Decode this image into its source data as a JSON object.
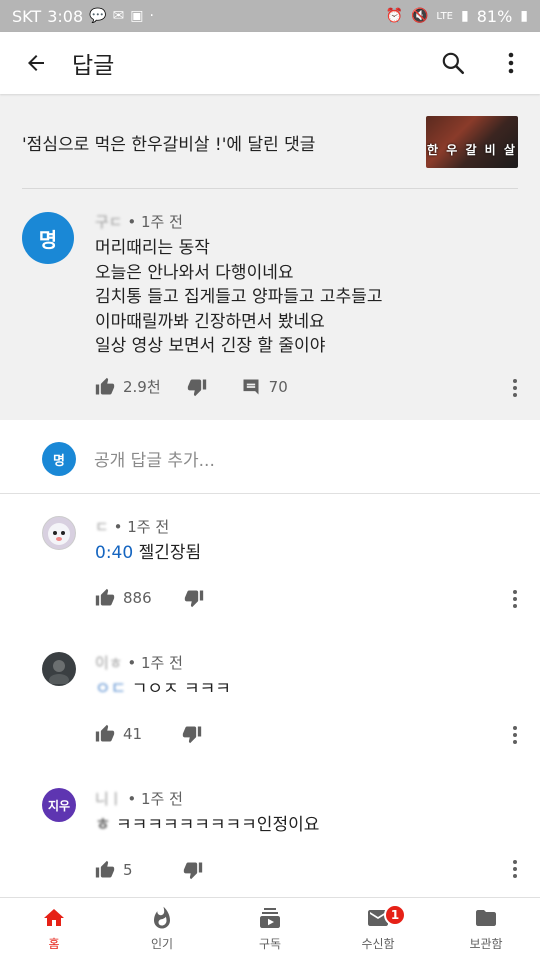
{
  "status_bar": {
    "carrier": "SKT",
    "time": "3:08",
    "network": "LTE",
    "battery": "81%"
  },
  "app_bar": {
    "title": "답글"
  },
  "video": {
    "reference_text": "'점심으로 먹은 한우갈비살 !'에 달린 댓글",
    "thumbnail_text": "한 우 갈 비 살"
  },
  "main_comment": {
    "avatar_initial": "명",
    "avatar_color": "#1a88d6",
    "author": "구ㄷ",
    "time": "• 1주 전",
    "lines": [
      "머리때리는 동작",
      "오늘은 안나와서 다행이네요",
      "김치통 들고 집게들고 양파들고 고추들고",
      "이마때릴까봐 긴장하면서 봤네요",
      "일상 영상 보면서 긴장 할 줄이야"
    ],
    "likes": "2.9천",
    "replies": "70"
  },
  "reply_input": {
    "avatar_initial": "명",
    "placeholder": "공개 답글 추가..."
  },
  "replies": [
    {
      "author": "ㄷ",
      "time": "• 1주 전",
      "timestamp_link": "0:40",
      "text": " 젤긴장됨",
      "likes": "886",
      "avatar_color": "#d8d0e0"
    },
    {
      "author": "이ㅎ",
      "time": "• 1주 전",
      "blur_prefix": "ㅇㄷ",
      "text": "ㄱㅇㅈ ㅋㅋㅋ",
      "likes": "41",
      "avatar_color": "#3a3f42"
    },
    {
      "author": "니ㅣ",
      "time": "• 1주 전",
      "avatar_initial": "지우",
      "blur_prefix": "ㅎ",
      "text": "ㅋㅋㅋㅋㅋㅋㅋㅋㅋ인정이요",
      "likes": "5",
      "avatar_color": "#5e35b1"
    }
  ],
  "bottom_nav": [
    {
      "label": "홈",
      "icon": "home-icon"
    },
    {
      "label": "인기",
      "icon": "flame-icon"
    },
    {
      "label": "구독",
      "icon": "subscriptions-icon"
    },
    {
      "label": "수신함",
      "icon": "inbox-icon",
      "badge": "1"
    },
    {
      "label": "보관함",
      "icon": "library-folder-icon"
    }
  ],
  "colors": {
    "accent": "#e62117",
    "link": "#1565c0"
  }
}
